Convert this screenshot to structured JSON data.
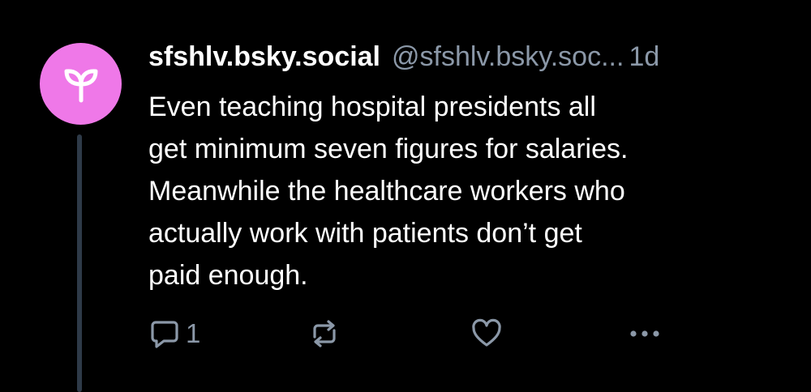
{
  "post": {
    "author": {
      "display_name": "sfshlv.bsky.social",
      "handle": "@sfshlv.bsky.soc...",
      "avatar_icon": "sprout-icon",
      "avatar_color": "#ef78e8"
    },
    "timestamp": "1d",
    "text": "Even teaching hospital presidents all\nget minimum seven figures for salaries.\nMeanwhile the healthcare workers who\nactually work with patients don’t get\npaid enough.",
    "actions": {
      "reply_icon": "reply-bubble-icon",
      "reply_count": "1",
      "repost_icon": "repost-icon",
      "like_icon": "heart-icon",
      "more_icon": "more-dots-icon"
    }
  },
  "colors": {
    "background": "#000000",
    "text": "#ffffff",
    "secondary_text": "#8b98a8",
    "thread_line": "#2e3a48"
  }
}
